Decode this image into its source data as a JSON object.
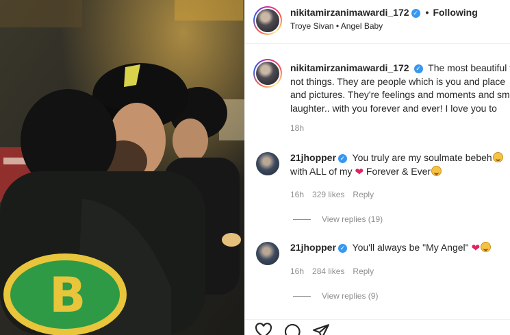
{
  "post_author": {
    "username": "nikitamirzanimawardi_172",
    "verified": true,
    "follow_status": "Following",
    "audio": "Troye Sivan • Angel Baby"
  },
  "caption": {
    "username": "nikitamirzanimawardi_172",
    "lines": [
      "The most beautiful t",
      "not things. They are people which is you and place",
      "and pictures. They're feelings and moments and sm",
      "laughter.. with you forever and ever! I love you to"
    ],
    "time": "18h"
  },
  "comments": [
    {
      "username": "21jhopper",
      "line1": "You truly are my soulmate bebeh",
      "line2_pre": "with ALL of my",
      "line2_post": "Forever & Ever",
      "time": "16h",
      "likes": "329 likes",
      "reply": "Reply",
      "view_replies": "View replies (19)"
    },
    {
      "username": "21jhopper",
      "text": "You'll always be \"My Angel\"",
      "time": "16h",
      "likes": "284 likes",
      "reply": "Reply",
      "view_replies": "View replies (9)"
    }
  ],
  "colors": {
    "verified_blue": "#3897f0",
    "secondary_text": "#8e8e8e",
    "heart_red": "#e0245e"
  },
  "icons": [
    "like-icon",
    "comment-icon",
    "share-icon"
  ]
}
